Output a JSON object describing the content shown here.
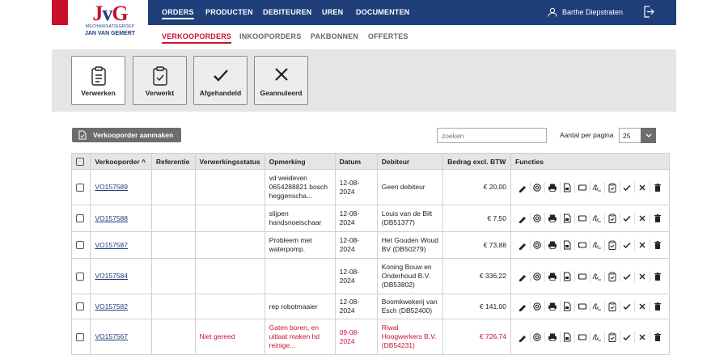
{
  "header": {
    "logo": {
      "mark": "JvG",
      "sub": "MECHANISATIEGROEP",
      "name": "JAN VAN GEMERT"
    },
    "nav": [
      "ORDERS",
      "PRODUCTEN",
      "DEBITEUREN",
      "UREN",
      "DOCUMENTEN"
    ],
    "user": "Barthe Diepstraten"
  },
  "subnav": [
    "VERKOOPORDERS",
    "INKOOPORDERS",
    "PAKBONNEN",
    "OFFERTES"
  ],
  "tiles": [
    "Verwerken",
    "Verwerkt",
    "Afgehandeld",
    "Geannuleerd"
  ],
  "toolbar": {
    "create_label": "Verkooporder aanmaken",
    "search_placeholder": "zoeken",
    "per_page_label": "Aantal per pagina",
    "per_page_value": "25"
  },
  "table": {
    "headers": [
      "Verkooporder ^",
      "Referentie",
      "Verwerkingsstatus",
      "Opmerking",
      "Datum",
      "Debiteur",
      "Bedrag excl. BTW",
      "Functies"
    ],
    "rows": [
      {
        "order": "VO157589",
        "ref": "",
        "status": "",
        "note": "vd weideven 0654288821 bosch heggenscha...",
        "date": "12-08-2024",
        "debtor": "Geen debiteur",
        "amount": "€ 20,00",
        "red": false
      },
      {
        "order": "VO157588",
        "ref": "",
        "status": "",
        "note": "slijpen handsnoeischaar",
        "date": "12-08-2024",
        "debtor": "Louis van de Bilt (DB51377)",
        "amount": "€ 7,50",
        "red": false
      },
      {
        "order": "VO157587",
        "ref": "",
        "status": "",
        "note": "Probleem met waterpomp.",
        "date": "12-08-2024",
        "debtor": "Het Gouden Woud BV (DB50279)",
        "amount": "€ 73,88",
        "red": false
      },
      {
        "order": "VO157584",
        "ref": "",
        "status": "",
        "note": "",
        "date": "12-08-2024",
        "debtor": "Koning Bouw en Onderhoud B.V. (DB53802)",
        "amount": "€ 336,22",
        "red": false
      },
      {
        "order": "VO157582",
        "ref": "",
        "status": "",
        "note": "rep robotmaaier",
        "date": "12-08-2024",
        "debtor": "Boomkwekerij van Esch (DB52400)",
        "amount": "€ 141,00",
        "red": false
      },
      {
        "order": "VO157567",
        "ref": "",
        "status": "Niet gereed",
        "note": "Gaten boren, en uitlaat maken hd reinige...",
        "date": "09-08-2024",
        "debtor": "Riwal Hoogwerkers B.V. (DB54231)",
        "amount": "€ 726,74",
        "red": true
      }
    ],
    "functions": [
      "edit-icon",
      "email-icon",
      "print-icon",
      "pdf-icon",
      "label-icon",
      "sign-icon",
      "clipboard-icon",
      "check-icon",
      "close-icon",
      "trash-icon"
    ]
  },
  "colors": {
    "brand_blue": "#1e3f7a",
    "brand_red": "#c8102e",
    "button_gray": "#6d6d6d"
  }
}
